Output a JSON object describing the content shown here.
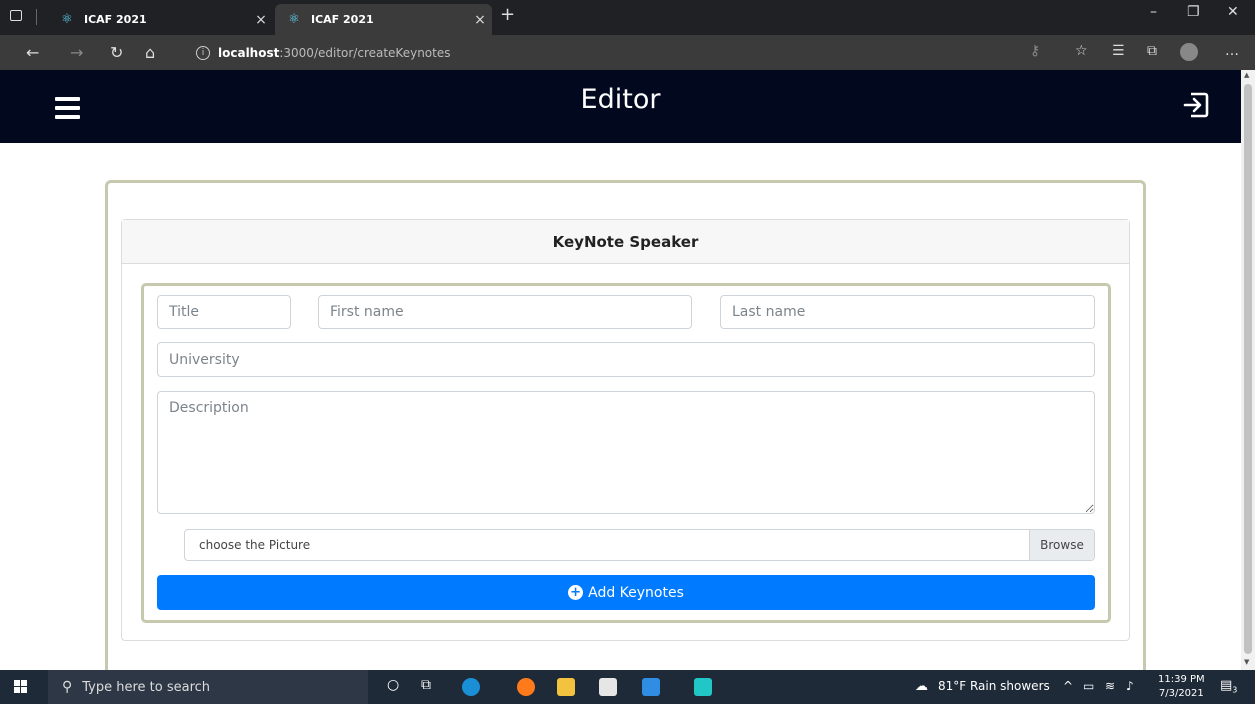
{
  "browser": {
    "tabs": [
      {
        "label": "ICAF 2021",
        "active": false
      },
      {
        "label": "ICAF 2021",
        "active": true
      }
    ],
    "url_host": "localhost",
    "url_path": ":3000/editor/createKeynotes"
  },
  "header": {
    "title": "Editor"
  },
  "card": {
    "title": "KeyNote Speaker"
  },
  "form": {
    "title_placeholder": "Title",
    "first_name_placeholder": "First name",
    "last_name_placeholder": "Last name",
    "university_placeholder": "University",
    "description_placeholder": "Description",
    "file_label": "choose the Picture",
    "browse_label": "Browse",
    "submit_label": "Add Keynotes"
  },
  "taskbar": {
    "search_placeholder": "Type here to search",
    "weather": "81°F  Rain showers",
    "time": "11:39 PM",
    "date": "7/3/2021",
    "notification_count": "3"
  },
  "colors": {
    "header_bg": "#02091f",
    "primary": "#007bff",
    "frame_border": "#c7c9ae"
  }
}
